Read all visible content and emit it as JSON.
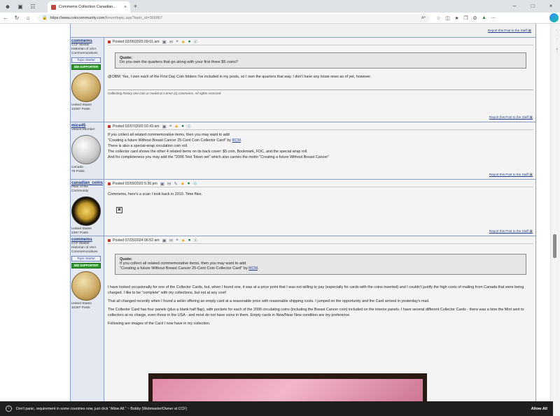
{
  "browser": {
    "tab_title": "Commems Collection Canadian...",
    "url_host": "https://www.coincommunity.com",
    "url_path": "/forum/topic.asp?topic_id=366867",
    "read_aloud": "Aᴬ"
  },
  "report_link": "Report this Post to the Staff",
  "posts": [
    {
      "user": "commems",
      "title": "CCF Master Historian of USA Commemoratives",
      "badge": "Topic Starter",
      "badge2": "$$$ SUPPORTER",
      "location": "United States",
      "posts": "10287 Posts",
      "date": "Posted 02/06/2020  09:01 am",
      "quote_label": "Quote:",
      "quote": "Do you own the quarters that go along with your first three $5 coins?",
      "body": "@OBM: Yes, I own each of the First Day Coin folders I've included in my posts, so I own the quarters that way. I don't have any loose ones as of yet, however.",
      "signature": "Collecting history one coin or medal at a time! (c) commems. All rights reserved."
    },
    {
      "user": "mice45",
      "title": "Valued Member",
      "location": "Canada",
      "posts": "78 Posts",
      "date": "Posted 02/07/2020  02:43 am",
      "lines": [
        "If you collect all related commemorative items, then you may want to add",
        "\"Creating a future Without Breast Cancer 25-Cent Coin Collector Card\" by ",
        "There is also a special-wrap circulation coin roll.",
        "The collector card shows the other 4 related items on its back cover: $5 coin, Bookmark, FDC, and the special wrap roll.",
        "And for completeness you may add the \"2006 Test Token set\" which also carries the motto \"Creating a future Without Breast Cancer\""
      ],
      "link": "RCM",
      "link_tail": "."
    },
    {
      "user": "canadian_coins",
      "title": "Pillar of the Community",
      "location": "United States",
      "posts": "2397 Posts",
      "date": "Posted 02/09/2020  5:36 pm",
      "body": "Commems, here's a scan I took back in 2010. Time flies."
    },
    {
      "user": "commems",
      "title": "CCF Master Historian of USA Commemoratives",
      "badge": "Topic Starter",
      "badge2": "$$$ SUPPORTER",
      "location": "United States",
      "posts": "10287 Posts",
      "date": "Posted 07/25/2024  06:52 am",
      "quote_label": "Quote:",
      "quote_line1": "If you collect all related commemorative items, then you may want to add",
      "quote_line2": "\"Creating a future Without Breast Cancer 25-Cent Coin Collector Card\" by ",
      "quote_link": "RCM",
      "quote_tail": ".",
      "paragraphs": [
        "I have looked occasionally for one of the Collector Cards, but, when I found one, it was at a price point that I was not willing to pay (especially for cards with the coins inserted) and I couldn't justify the high costs of mailing from Canada that were being charged. I like to be \"complete\" with my collections, but not at any cost!",
        "That all changed recently when I found a seller offering an empty card at a reasonable price with reasonable shipping costs. I jumped on the opportunity and the Card arrived in yesterday's mail.",
        "The Collector Card has four panels (plus a blank half flap), with pockets for each of the 2006 circulating coins (including the Breast Cancer coin) included on the interior panels. I have several different Collector Cards - there was a time the Mint sent to collectors at no charge, even those in the USA - and most do not have coins in them. Empty cards in New/Near New condition are my preference.",
        "Following are images of the Card I now have in my collection."
      ]
    }
  ],
  "cookie": {
    "message": "Don't panic, requirement in some countries now, just click \"Allow All.\" ~ Bobby (Webmaster/Owner at CCF)",
    "button": "Allow All"
  }
}
